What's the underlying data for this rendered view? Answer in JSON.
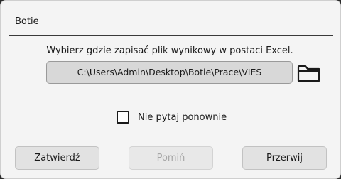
{
  "dialog": {
    "title": "Botie",
    "prompt": "Wybierz gdzie zapisać plik wynikowy w postaci Excel.",
    "path_value": "C:\\Users\\Admin\\Desktop\\Botie\\Prace\\VIES",
    "browse_icon": "folder-icon",
    "dont_ask_label": "Nie pytaj ponownie",
    "dont_ask_checked": false
  },
  "buttons": {
    "confirm": "Zatwierdź",
    "skip": "Pomiń",
    "abort": "Przerwij"
  }
}
